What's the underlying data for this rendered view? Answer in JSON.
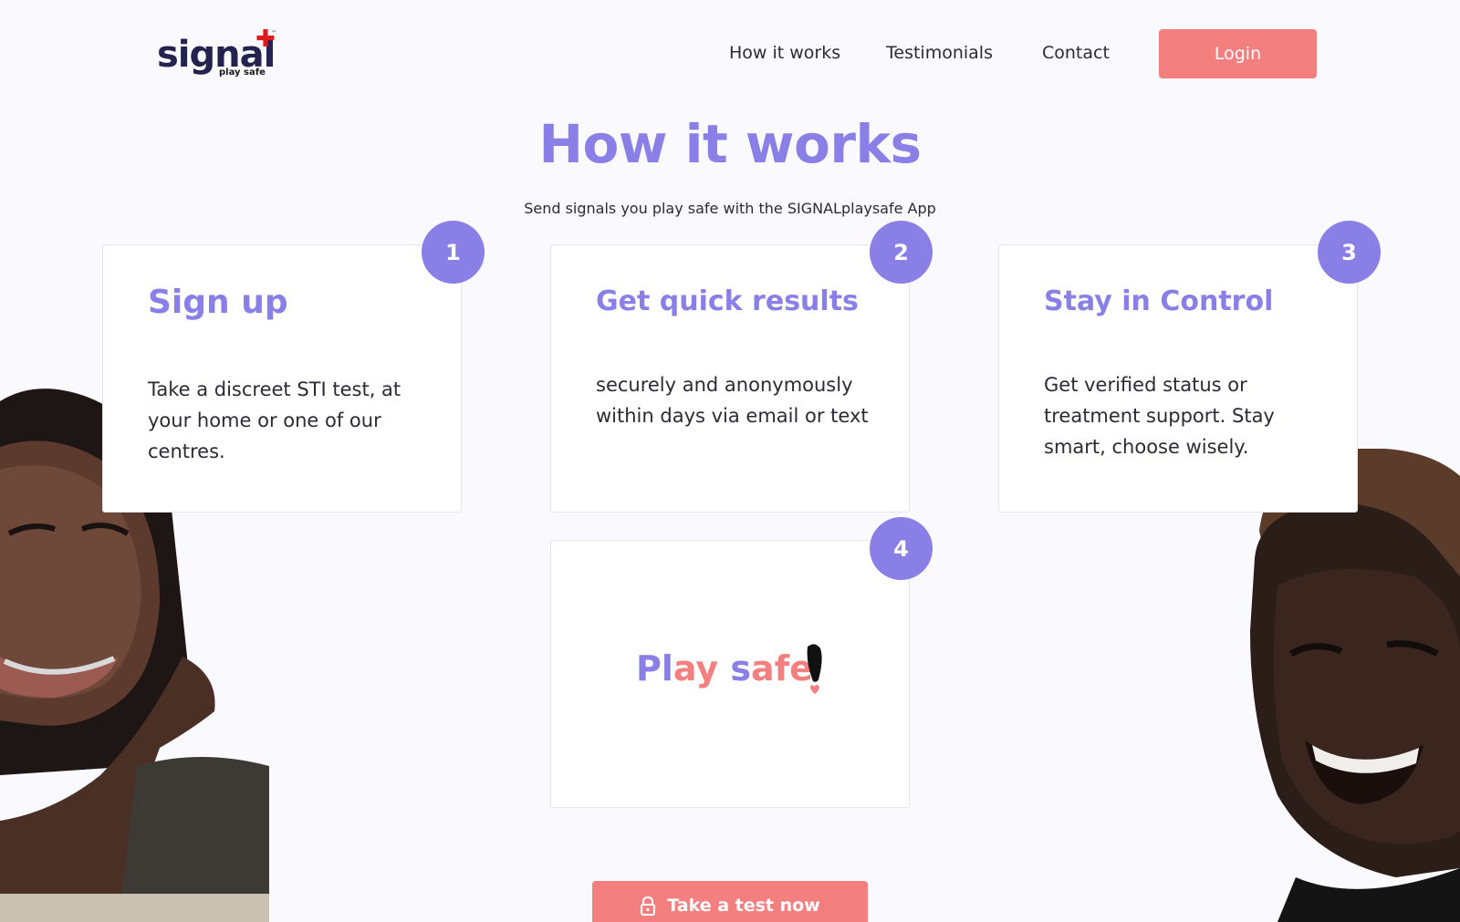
{
  "header": {
    "logo": {
      "word": "signal",
      "tagline": "play safe",
      "mark": "™"
    },
    "nav": [
      "How it works",
      "Testimonials",
      "Contact"
    ],
    "login_label": "Login"
  },
  "section": {
    "title": "How it works",
    "subtitle": "Send signals you play safe with the SIGNALplaysafe App"
  },
  "steps": [
    {
      "number": "1",
      "title": "Sign up",
      "text": "Take a discreet STI test, at your home or one of our centres."
    },
    {
      "number": "2",
      "title": "Get quick results",
      "text": "securely and anonymously within days via email or text"
    },
    {
      "number": "3",
      "title": "Stay in Control",
      "text": "Get verified status or treatment support. Stay smart, choose wisely."
    },
    {
      "number": "4",
      "image_text": {
        "p1": "Pl",
        "p2": "ay",
        "p3": " s",
        "p4": "afe"
      }
    }
  ],
  "cta": {
    "label": "Take a test now",
    "icon": "lock-icon"
  },
  "colors": {
    "accent": "#8a7fe6",
    "coral": "#f47f7f",
    "background": "#faf9fd",
    "logo_red": "#e0191d"
  }
}
